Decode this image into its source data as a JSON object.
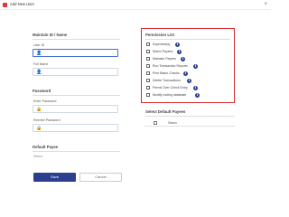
{
  "window": {
    "title": "Add New User",
    "close_glyph": "×"
  },
  "maintain": {
    "section_title": "Maintain ID / Name",
    "user_id_label": "User ID",
    "full_name_label": "Full Name"
  },
  "password": {
    "section_title": "Password",
    "enter_label": "Enter Password",
    "reenter_label": "Reenter Password"
  },
  "default_payee": {
    "section_title": "Default Payee",
    "value": "Select"
  },
  "buttons": {
    "save": "Save",
    "cancel": "Cancel"
  },
  "permissions": {
    "title": "Permission List",
    "items": [
      {
        "label": "Expenses(s)",
        "has_info": true
      },
      {
        "label": "Select Payees",
        "has_info": true
      },
      {
        "label": "Maintain Payees",
        "has_info": true
      },
      {
        "label": "Run Transaction Reports",
        "has_info": true
      },
      {
        "label": "Print Batch Checks",
        "has_info": true
      },
      {
        "label": "Delete Transactions",
        "has_info": true
      },
      {
        "label": "Permit Over Check Entry",
        "has_info": true
      },
      {
        "label": "Modify routing database",
        "has_info": true
      }
    ],
    "info_glyph": "i"
  },
  "select_default_payees": {
    "title": "Select Default Payees",
    "column_label": "Status"
  },
  "icons": {
    "app": "app-logo-icon",
    "user": "user-icon",
    "lock": "lock-icon"
  },
  "colors": {
    "accent": "#2c3f8f",
    "highlight_border": "#d62a30"
  }
}
